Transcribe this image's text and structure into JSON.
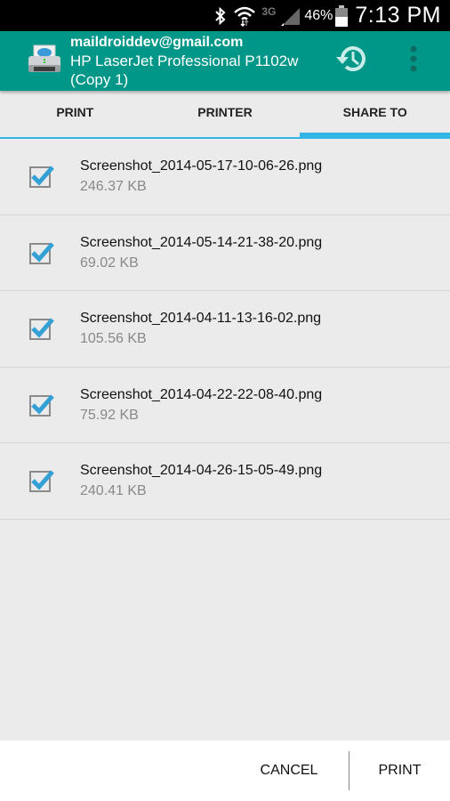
{
  "status_bar": {
    "network": "3G",
    "battery_percent": "46%",
    "time": "7:13 PM",
    "icons": [
      "bluetooth-icon",
      "wifi-icon",
      "signal-icon",
      "battery-icon"
    ]
  },
  "app_bar": {
    "account": "maildroiddev@gmail.com",
    "printer_line1": "HP LaserJet Professional P1102w",
    "printer_line2": "(Copy 1)",
    "icons": [
      "printer-cloud-icon",
      "history-icon",
      "overflow-menu-icon"
    ]
  },
  "tabs": [
    {
      "label": "PRINT",
      "active": false
    },
    {
      "label": "PRINTER",
      "active": false
    },
    {
      "label": "SHARE TO",
      "active": true
    }
  ],
  "files": [
    {
      "name": "Screenshot_2014-05-17-10-06-26.png",
      "size": "246.37 KB",
      "checked": true
    },
    {
      "name": "Screenshot_2014-05-14-21-38-20.png",
      "size": "69.02 KB",
      "checked": true
    },
    {
      "name": "Screenshot_2014-04-11-13-16-02.png",
      "size": "105.56 KB",
      "checked": true
    },
    {
      "name": "Screenshot_2014-04-22-22-08-40.png",
      "size": "75.92 KB",
      "checked": true
    },
    {
      "name": "Screenshot_2014-04-26-15-05-49.png",
      "size": "240.41 KB",
      "checked": true
    }
  ],
  "bottom_bar": {
    "cancel_label": "CANCEL",
    "print_label": "PRINT"
  },
  "colors": {
    "app_bar": "#009688",
    "tab_indicator": "#33b5e5",
    "check": "#33a1d6"
  }
}
